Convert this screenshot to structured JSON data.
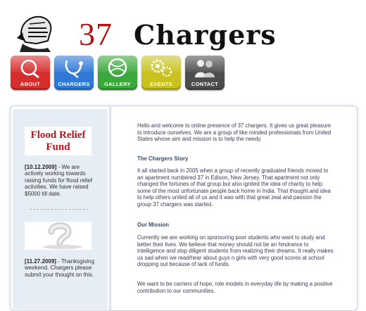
{
  "logo": {
    "number": "37",
    "word": "Chargers"
  },
  "nav": [
    {
      "label": "ABOUT",
      "color": "#d62d2d"
    },
    {
      "label": "CHARGERS",
      "color": "#2f78d6"
    },
    {
      "label": "GALLERY",
      "color": "#3aa83a"
    },
    {
      "label": "EVENTS",
      "color": "#c9c21e"
    },
    {
      "label": "CONTACT",
      "color": "#4d4d4d"
    }
  ],
  "sidebar": {
    "flood_title_line1": "Flood Relief",
    "flood_title_line2": "Fund",
    "news1": {
      "date": "[10.12.2009]",
      "text": " - We are actively working towards raising funds for flood relief activities. We have raised $5000 till date."
    },
    "dashes": "- - - - - - - - - - - - - -",
    "news2": {
      "date": "[11.27.2009]",
      "text": " - Thanksgiving weekend. Chargers please submit your thought on this."
    }
  },
  "content": {
    "intro": "Hello and welcome to online presence of 37 chargers. It gives us great pleasure to introduce ourselves. We are a group of like minded professionals from United States whose aim and mission is to help the needy.",
    "story_heading": "The Chargers Story",
    "story": "It all started back in 2005 when a group of recently graduated friends moved to an apartment numbered 37 in Edison, New Jersey. That apartment not only changed the fortunes of that group but also ignited the idea of charity to help some of the most unfortunate people back home in India. That thought and idea to help others united all of us and it was with that great zeal and passion the group 37 chargers was started.",
    "mission_heading": "Our Mission",
    "mission": "Currently we are working on sponsoring poor students who want to study and better their lives. We believe that money should not be an hindrance to intelligence and stop diligent students from realizing their dreams. It really makes us sad when we read/hear about guys n girls with very good scores at school dropping out because of lack of funds.",
    "closing": "We want to be carriers of hope, role models in everyday life by making a positive contribution to our communities."
  }
}
